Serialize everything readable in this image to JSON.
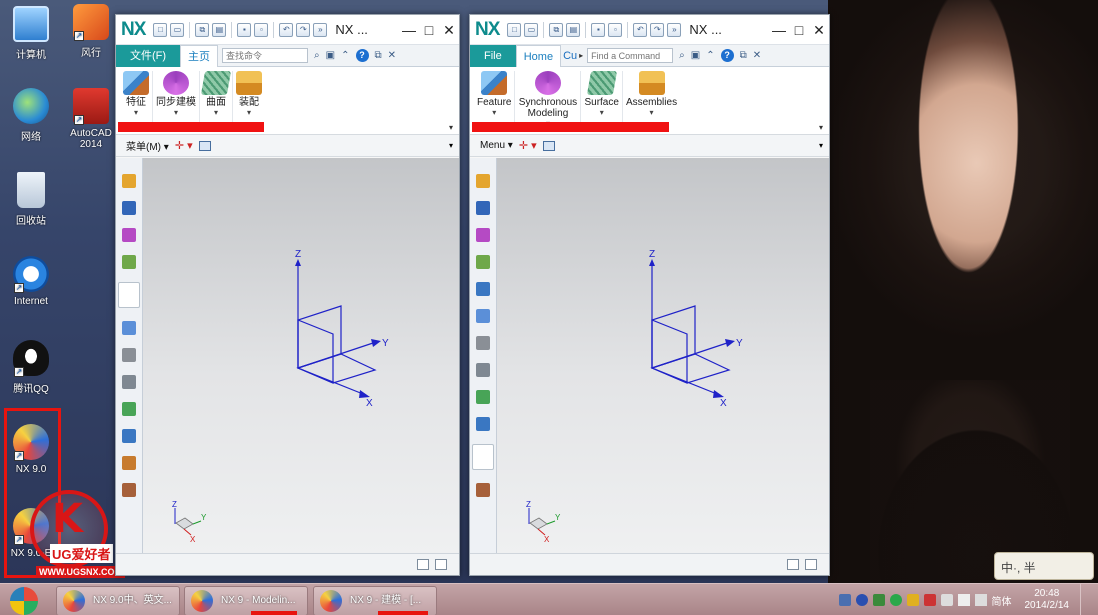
{
  "desktop_icons": [
    {
      "id": "computer",
      "label": "计算机"
    },
    {
      "id": "storm",
      "label": "风行"
    },
    {
      "id": "network",
      "label": "网络"
    },
    {
      "id": "autocad",
      "label": "AutoCAD 2014"
    },
    {
      "id": "recycle",
      "label": "回收站"
    },
    {
      "id": "internet",
      "label": "Internet"
    },
    {
      "id": "qq",
      "label": "腾讯QQ"
    },
    {
      "id": "nx9",
      "label": "NX 9.0"
    },
    {
      "id": "nx9e",
      "label": "NX 9.0-E"
    }
  ],
  "watermark": {
    "brand_letter": "K",
    "cn_text": "UG爱好者",
    "url": "WWW.UGSNX.COM",
    "color": "#d91616"
  },
  "widget_text": "中·, 半",
  "win_left": {
    "logo": "NX",
    "title": "NX ...",
    "file_tab": "文件(F)",
    "tabs": [
      "主页"
    ],
    "search_placeholder": "查找命令",
    "ribbon": [
      {
        "label": "特征",
        "icon": "feature-icon"
      },
      {
        "label": "同步建模",
        "icon": "synchronous-modeling-icon"
      },
      {
        "label": "曲面",
        "icon": "surface-icon"
      },
      {
        "label": "装配",
        "icon": "assembly-icon"
      }
    ],
    "menu_label": "菜单(M)",
    "triad": {
      "z": "Z",
      "y": "Y",
      "x": "X"
    }
  },
  "win_right": {
    "logo": "NX",
    "title": "NX ...",
    "file_tab": "File",
    "tabs": [
      "Home",
      "Cu"
    ],
    "search_placeholder": "Find a Command",
    "ribbon": [
      {
        "label": "Feature",
        "icon": "feature-icon"
      },
      {
        "label": "Synchronous Modeling",
        "icon": "synchronous-modeling-icon"
      },
      {
        "label": "Surface",
        "icon": "surface-icon"
      },
      {
        "label": "Assemblies",
        "icon": "assembly-icon"
      }
    ],
    "menu_label": "Menu",
    "triad": {
      "z": "Z",
      "y": "Y",
      "x": "X"
    }
  },
  "taskbar": {
    "items": [
      {
        "label": "NX 9.0中、英文...",
        "underline": false
      },
      {
        "label": "NX 9 - Modelin...",
        "underline": true
      },
      {
        "label": "NX 9 - 建模 - [...",
        "underline": true
      }
    ],
    "tray_lang": "简体",
    "time": "20:48",
    "date": "2014/2/14"
  },
  "colors": {
    "nx_teal": "#1b9a9a",
    "highlight_red": "#e8140f",
    "triad_blue": "#1f22c8"
  }
}
